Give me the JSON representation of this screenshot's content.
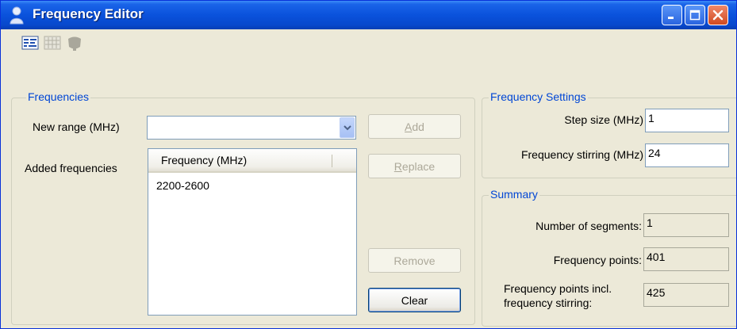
{
  "window": {
    "title": "Frequency Editor",
    "icon": "person-icon",
    "controls": [
      "minimize",
      "maximize",
      "close"
    ]
  },
  "toolbar": {
    "tools": [
      {
        "name": "frequency-list-icon",
        "enabled": true
      },
      {
        "name": "frequency-grid-icon",
        "enabled": false
      },
      {
        "name": "antenna-icon",
        "enabled": false
      }
    ]
  },
  "frequencies": {
    "legend": "Frequencies",
    "new_range_label": "New range (MHz)",
    "new_range_value": "",
    "added_label": "Added frequencies",
    "column_header": "Frequency (MHz)",
    "rows": [
      "2200-2600"
    ],
    "buttons": {
      "add": {
        "mnemonic": "A",
        "rest": "dd",
        "enabled": false
      },
      "replace": {
        "mnemonic": "R",
        "rest": "eplace",
        "enabled": false
      },
      "remove": {
        "label": "Remove",
        "enabled": false
      },
      "clear": {
        "label": "Clear",
        "enabled": true
      }
    }
  },
  "settings": {
    "legend": "Frequency Settings",
    "step_label": "Step size (MHz)",
    "step_value": "1",
    "stirring_label": "Frequency stirring (MHz)",
    "stirring_value": "24"
  },
  "summary": {
    "legend": "Summary",
    "segments_label": "Number of segments:",
    "segments_value": "1",
    "points_label": "Frequency points:",
    "points_value": "401",
    "points_incl_label_line1": "Frequency points incl.",
    "points_incl_label_line2": "frequency stirring:",
    "points_incl_value": "425"
  },
  "colors": {
    "title_bar": "#0a52dc",
    "window_bg": "#ece9d8",
    "group_legend": "#0046d5",
    "close_button": "#d04a20"
  }
}
